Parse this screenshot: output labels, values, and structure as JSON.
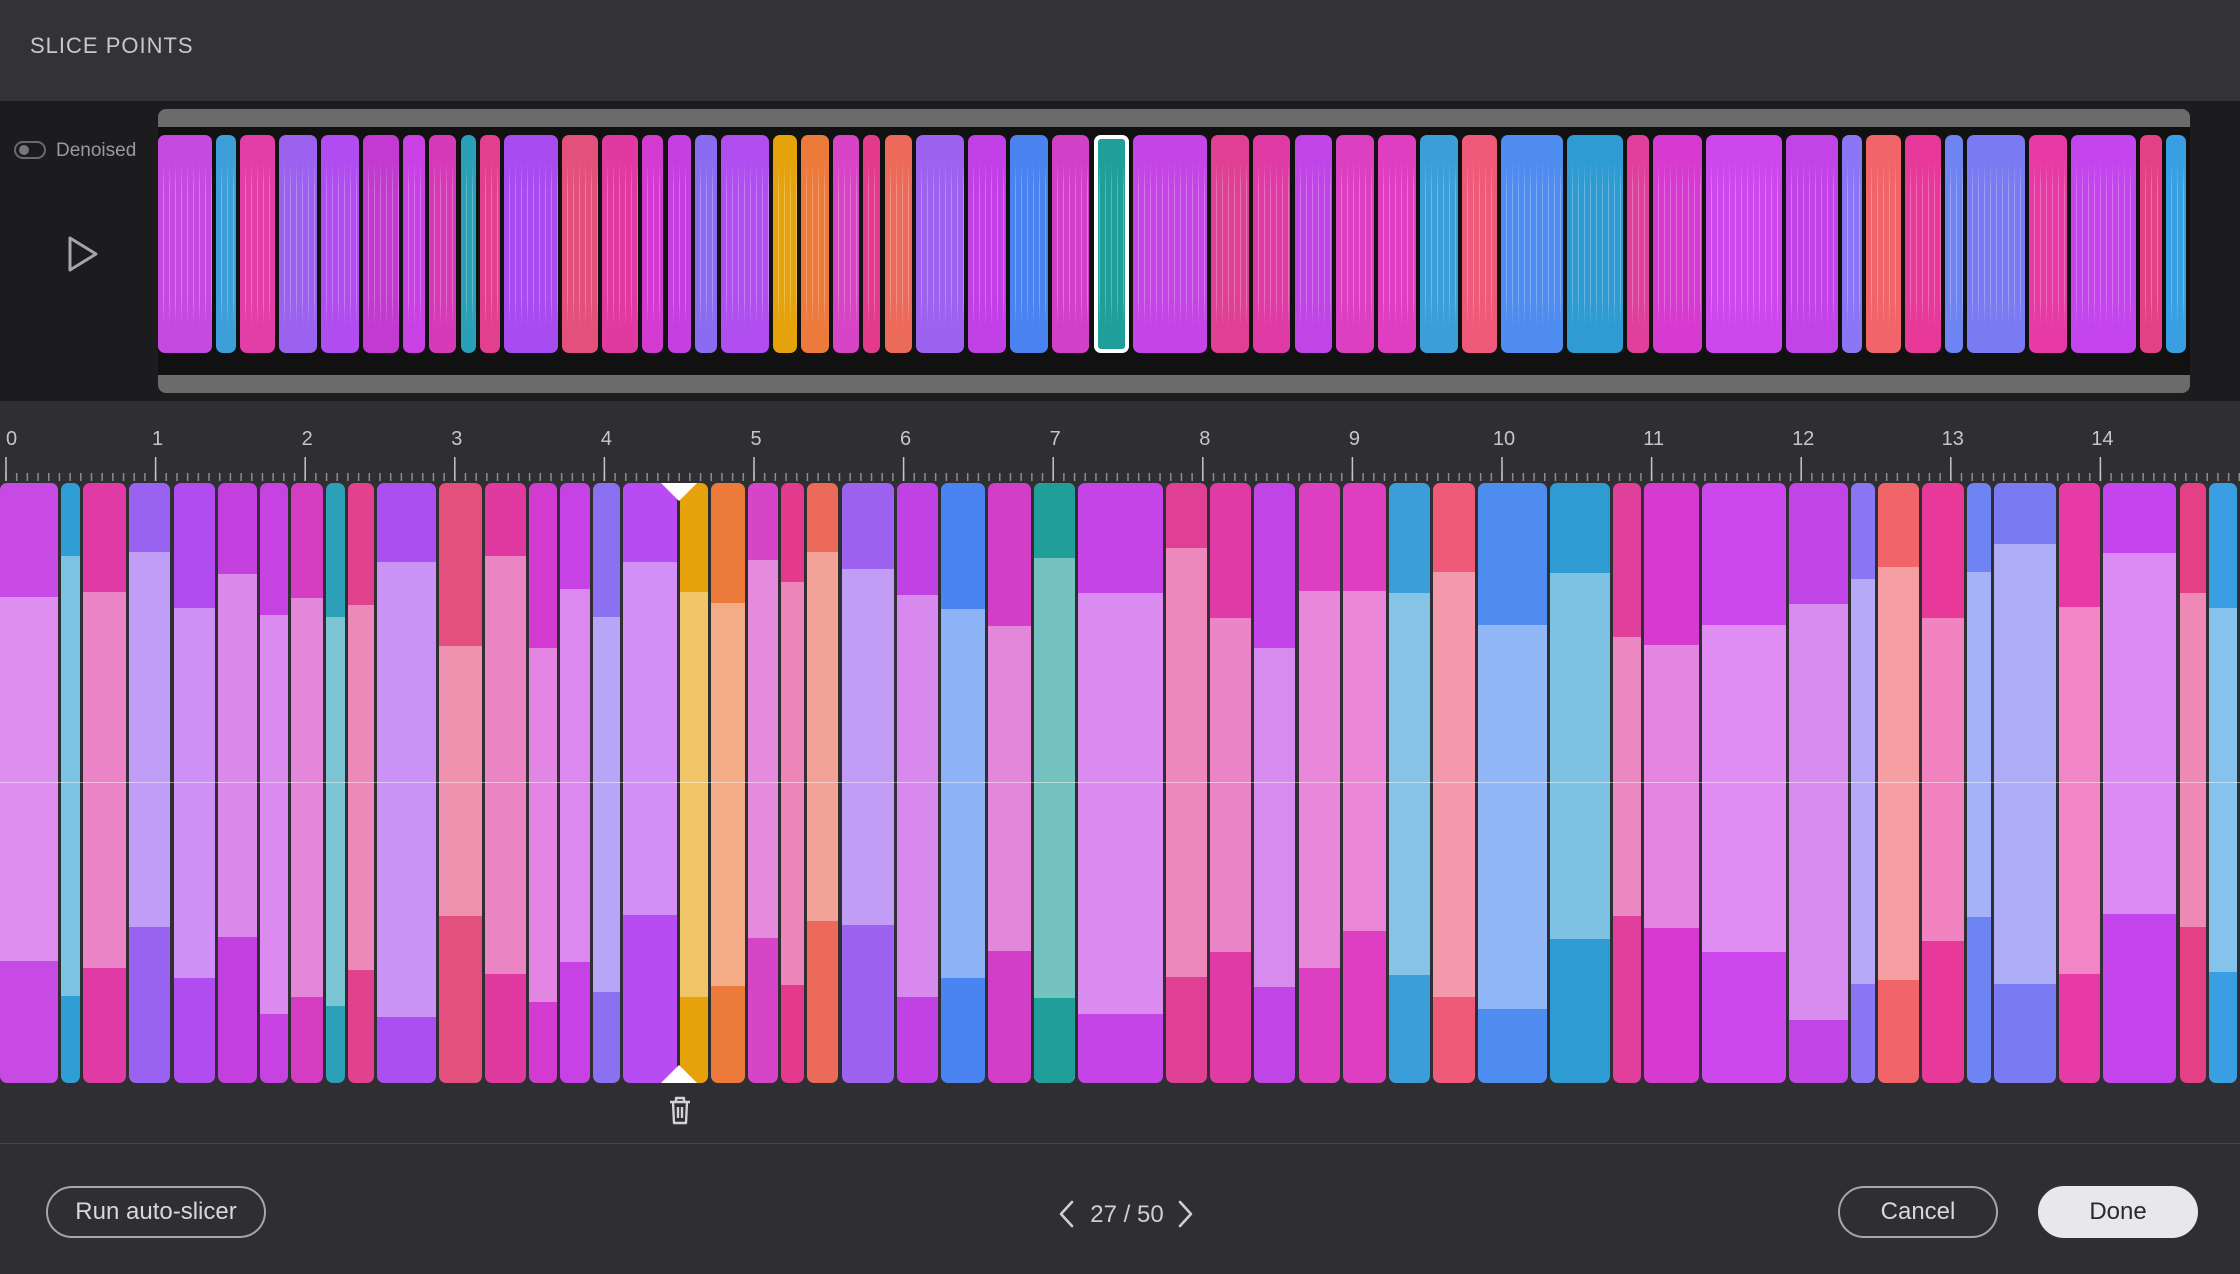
{
  "header": {
    "title": "SLICE POINTS"
  },
  "overview": {
    "denoise_label": "Denoised",
    "denoise_on": false,
    "segments": [
      {
        "color": "#c44ae0",
        "w": 54
      },
      {
        "color": "#3d9fd8",
        "w": 20
      },
      {
        "color": "#e23ea8",
        "w": 36
      },
      {
        "color": "#9b62f0",
        "w": 38
      },
      {
        "color": "#b04cf0",
        "w": 38
      },
      {
        "color": "#c23ad0",
        "w": 36
      },
      {
        "color": "#c940e4",
        "w": 22
      },
      {
        "color": "#d63ab8",
        "w": 28
      },
      {
        "color": "#2aa0b8",
        "w": 16
      },
      {
        "color": "#e2408e",
        "w": 20
      },
      {
        "color": "#a84cf0",
        "w": 54
      },
      {
        "color": "#e4507c",
        "w": 36
      },
      {
        "color": "#e03aa0",
        "w": 36
      },
      {
        "color": "#d23ad0",
        "w": 22
      },
      {
        "color": "#c43ee0",
        "w": 24
      },
      {
        "color": "#8a6cf0",
        "w": 22
      },
      {
        "color": "#b04ef0",
        "w": 48
      },
      {
        "color": "#e6a20a",
        "w": 24
      },
      {
        "color": "#ec7a3a",
        "w": 28
      },
      {
        "color": "#d844c6",
        "w": 26
      },
      {
        "color": "#e43a8e",
        "w": 18
      },
      {
        "color": "#ec6a5a",
        "w": 28
      },
      {
        "color": "#9d62f0",
        "w": 48
      },
      {
        "color": "#c040e6",
        "w": 38
      },
      {
        "color": "#4a82f0",
        "w": 38
      },
      {
        "color": "#d240c8",
        "w": 38
      },
      {
        "color": "#1f9e9a",
        "w": 36,
        "selected": true
      },
      {
        "color": "#c444e6",
        "w": 74
      },
      {
        "color": "#e04094",
        "w": 38
      },
      {
        "color": "#e03aa6",
        "w": 38
      },
      {
        "color": "#c044e6",
        "w": 38
      },
      {
        "color": "#dc40c0",
        "w": 38
      },
      {
        "color": "#e03ec0",
        "w": 38
      },
      {
        "color": "#3b9ed8",
        "w": 38
      },
      {
        "color": "#ee5a78",
        "w": 36
      },
      {
        "color": "#4f8cf0",
        "w": 62
      },
      {
        "color": "#2e9cd2",
        "w": 56
      },
      {
        "color": "#e0409c",
        "w": 22
      },
      {
        "color": "#d63ad0",
        "w": 50
      },
      {
        "color": "#cc48ec",
        "w": 76
      },
      {
        "color": "#c044e6",
        "w": 52
      },
      {
        "color": "#8a76f4",
        "w": 20
      },
      {
        "color": "#f0646a",
        "w": 36
      },
      {
        "color": "#e8389a",
        "w": 36
      },
      {
        "color": "#6e84f2",
        "w": 18
      },
      {
        "color": "#7a7af2",
        "w": 58
      },
      {
        "color": "#e83aa4",
        "w": 38
      },
      {
        "color": "#c444ee",
        "w": 66
      },
      {
        "color": "#e44086",
        "w": 22
      },
      {
        "color": "#3a9ee2",
        "w": 20
      }
    ]
  },
  "ruler": {
    "labels": [
      "0",
      "1",
      "2",
      "3",
      "4",
      "5",
      "6",
      "7",
      "8",
      "9",
      "10",
      "11",
      "12",
      "13",
      "14"
    ]
  },
  "editor": {
    "slices": [
      {
        "color": "#c84ae4",
        "w": 62
      },
      {
        "color": "#2e9ed4",
        "w": 20
      },
      {
        "color": "#e03aa6",
        "w": 46
      },
      {
        "color": "#9a62f0",
        "w": 44
      },
      {
        "color": "#b04cf0",
        "w": 44
      },
      {
        "color": "#c440de",
        "w": 42
      },
      {
        "color": "#c643e2",
        "w": 30
      },
      {
        "color": "#d43cc2",
        "w": 34
      },
      {
        "color": "#2ba0b6",
        "w": 20
      },
      {
        "color": "#e2418e",
        "w": 28
      },
      {
        "color": "#ac4ff0",
        "w": 62
      },
      {
        "color": "#e4507e",
        "w": 46
      },
      {
        "color": "#e03aa0",
        "w": 44
      },
      {
        "color": "#d23ad0",
        "w": 30
      },
      {
        "color": "#c642e4",
        "w": 32
      },
      {
        "color": "#8c70f2",
        "w": 28
      },
      {
        "color": "#b64cf2",
        "w": 58
      },
      {
        "color": "#e6a20a",
        "w": 30
      },
      {
        "color": "#ec7a3a",
        "w": 36
      },
      {
        "color": "#d644c8",
        "w": 32
      },
      {
        "color": "#e43a8e",
        "w": 24
      },
      {
        "color": "#ec6a5a",
        "w": 34
      },
      {
        "color": "#9d62f0",
        "w": 56
      },
      {
        "color": "#c042e4",
        "w": 44
      },
      {
        "color": "#4a84f0",
        "w": 46
      },
      {
        "color": "#d23ec6",
        "w": 46
      },
      {
        "color": "#1f9e9a",
        "w": 44,
        "selected": true
      },
      {
        "color": "#c444e6",
        "w": 90
      },
      {
        "color": "#e04094",
        "w": 44
      },
      {
        "color": "#e03aa6",
        "w": 44
      },
      {
        "color": "#c044e6",
        "w": 44
      },
      {
        "color": "#dc40c0",
        "w": 44
      },
      {
        "color": "#e03ec0",
        "w": 46
      },
      {
        "color": "#3b9ed8",
        "w": 44
      },
      {
        "color": "#ee5a78",
        "w": 44
      },
      {
        "color": "#4f8cf0",
        "w": 74
      },
      {
        "color": "#2e9cd2",
        "w": 64
      },
      {
        "color": "#e0409c",
        "w": 30
      },
      {
        "color": "#d63ad0",
        "w": 58
      },
      {
        "color": "#cc48ec",
        "w": 90
      },
      {
        "color": "#c044e6",
        "w": 62
      },
      {
        "color": "#8a76f4",
        "w": 26
      },
      {
        "color": "#f0646a",
        "w": 44
      },
      {
        "color": "#e8389a",
        "w": 44
      },
      {
        "color": "#6e84f2",
        "w": 26
      },
      {
        "color": "#7a7af2",
        "w": 66
      },
      {
        "color": "#e83aa4",
        "w": 44
      },
      {
        "color": "#c444ee",
        "w": 78
      },
      {
        "color": "#e44086",
        "w": 28
      },
      {
        "color": "#3a9ee2",
        "w": 30
      }
    ],
    "delete_tooltip": ""
  },
  "footer": {
    "run_label": "Run auto-slicer",
    "page_text": "27 / 50",
    "cancel_label": "Cancel",
    "done_label": "Done"
  },
  "icons": {
    "play": "play-icon",
    "trash": "trash-icon",
    "prev": "chevron-left-icon",
    "next": "chevron-right-icon",
    "toggle": "toggle-icon"
  }
}
